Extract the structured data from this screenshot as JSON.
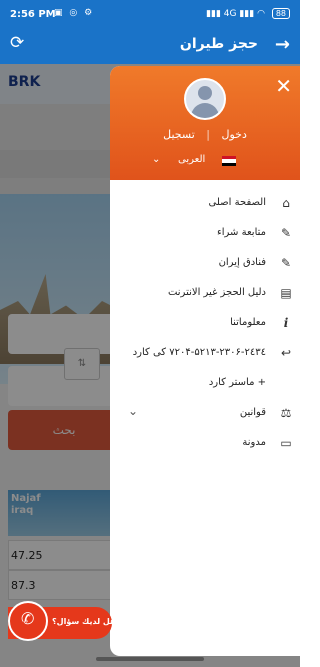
{
  "status": {
    "time": "2:56 PM",
    "icons": "▣ ◎ ⚙",
    "signal": "▮▮▮ 4G ▮▮▮ ◠",
    "battery": "88"
  },
  "appbar": {
    "title": "حجز طيران",
    "back_icon": "→",
    "refresh_icon": "⟳"
  },
  "background": {
    "logo": "BRK",
    "swap_label": "⇅",
    "search_label": "بحث",
    "promo_line1": "Najaf",
    "promo_line2": "iraq",
    "rows": [
      "47.25",
      "87.3"
    ]
  },
  "drawer": {
    "close_icon": "✕",
    "login": "دخول",
    "register": "تسجيل",
    "lang_label": "العربی",
    "lang_arrow": "⌄",
    "flag_colors": [
      "#ce1126",
      "#ffffff",
      "#000000"
    ],
    "items": [
      {
        "label": "الصفحة اصلی",
        "icon": "home-icon",
        "glyph": "⌂"
      },
      {
        "label": "متابعة شراء",
        "icon": "ticket-icon",
        "glyph": "✎"
      },
      {
        "label": "فنادق إيران",
        "icon": "hotel-icon",
        "glyph": "✎"
      },
      {
        "label": "دليل الحجز غير الانترنت",
        "icon": "book-icon",
        "glyph": "▤"
      },
      {
        "label": "معلوماتنا",
        "icon": "info-icon",
        "glyph": "i"
      },
      {
        "label": "٢٤٣٤-٢٣٠۶-٧٢٠۴-۵٢١٣ کی کارد",
        "icon": "reply-icon",
        "glyph": "↩"
      },
      {
        "label": "+ ماستر كارد",
        "icon": "none",
        "glyph": ""
      },
      {
        "label": "قوانین",
        "icon": "scales-icon",
        "glyph": "⚖",
        "chevron": "⌄"
      },
      {
        "label": "مدونة",
        "icon": "folder-icon",
        "glyph": "▭"
      }
    ]
  },
  "fab": {
    "text": "هل لديك سؤال؟",
    "icon": "phone-icon",
    "glyph": "✆"
  }
}
